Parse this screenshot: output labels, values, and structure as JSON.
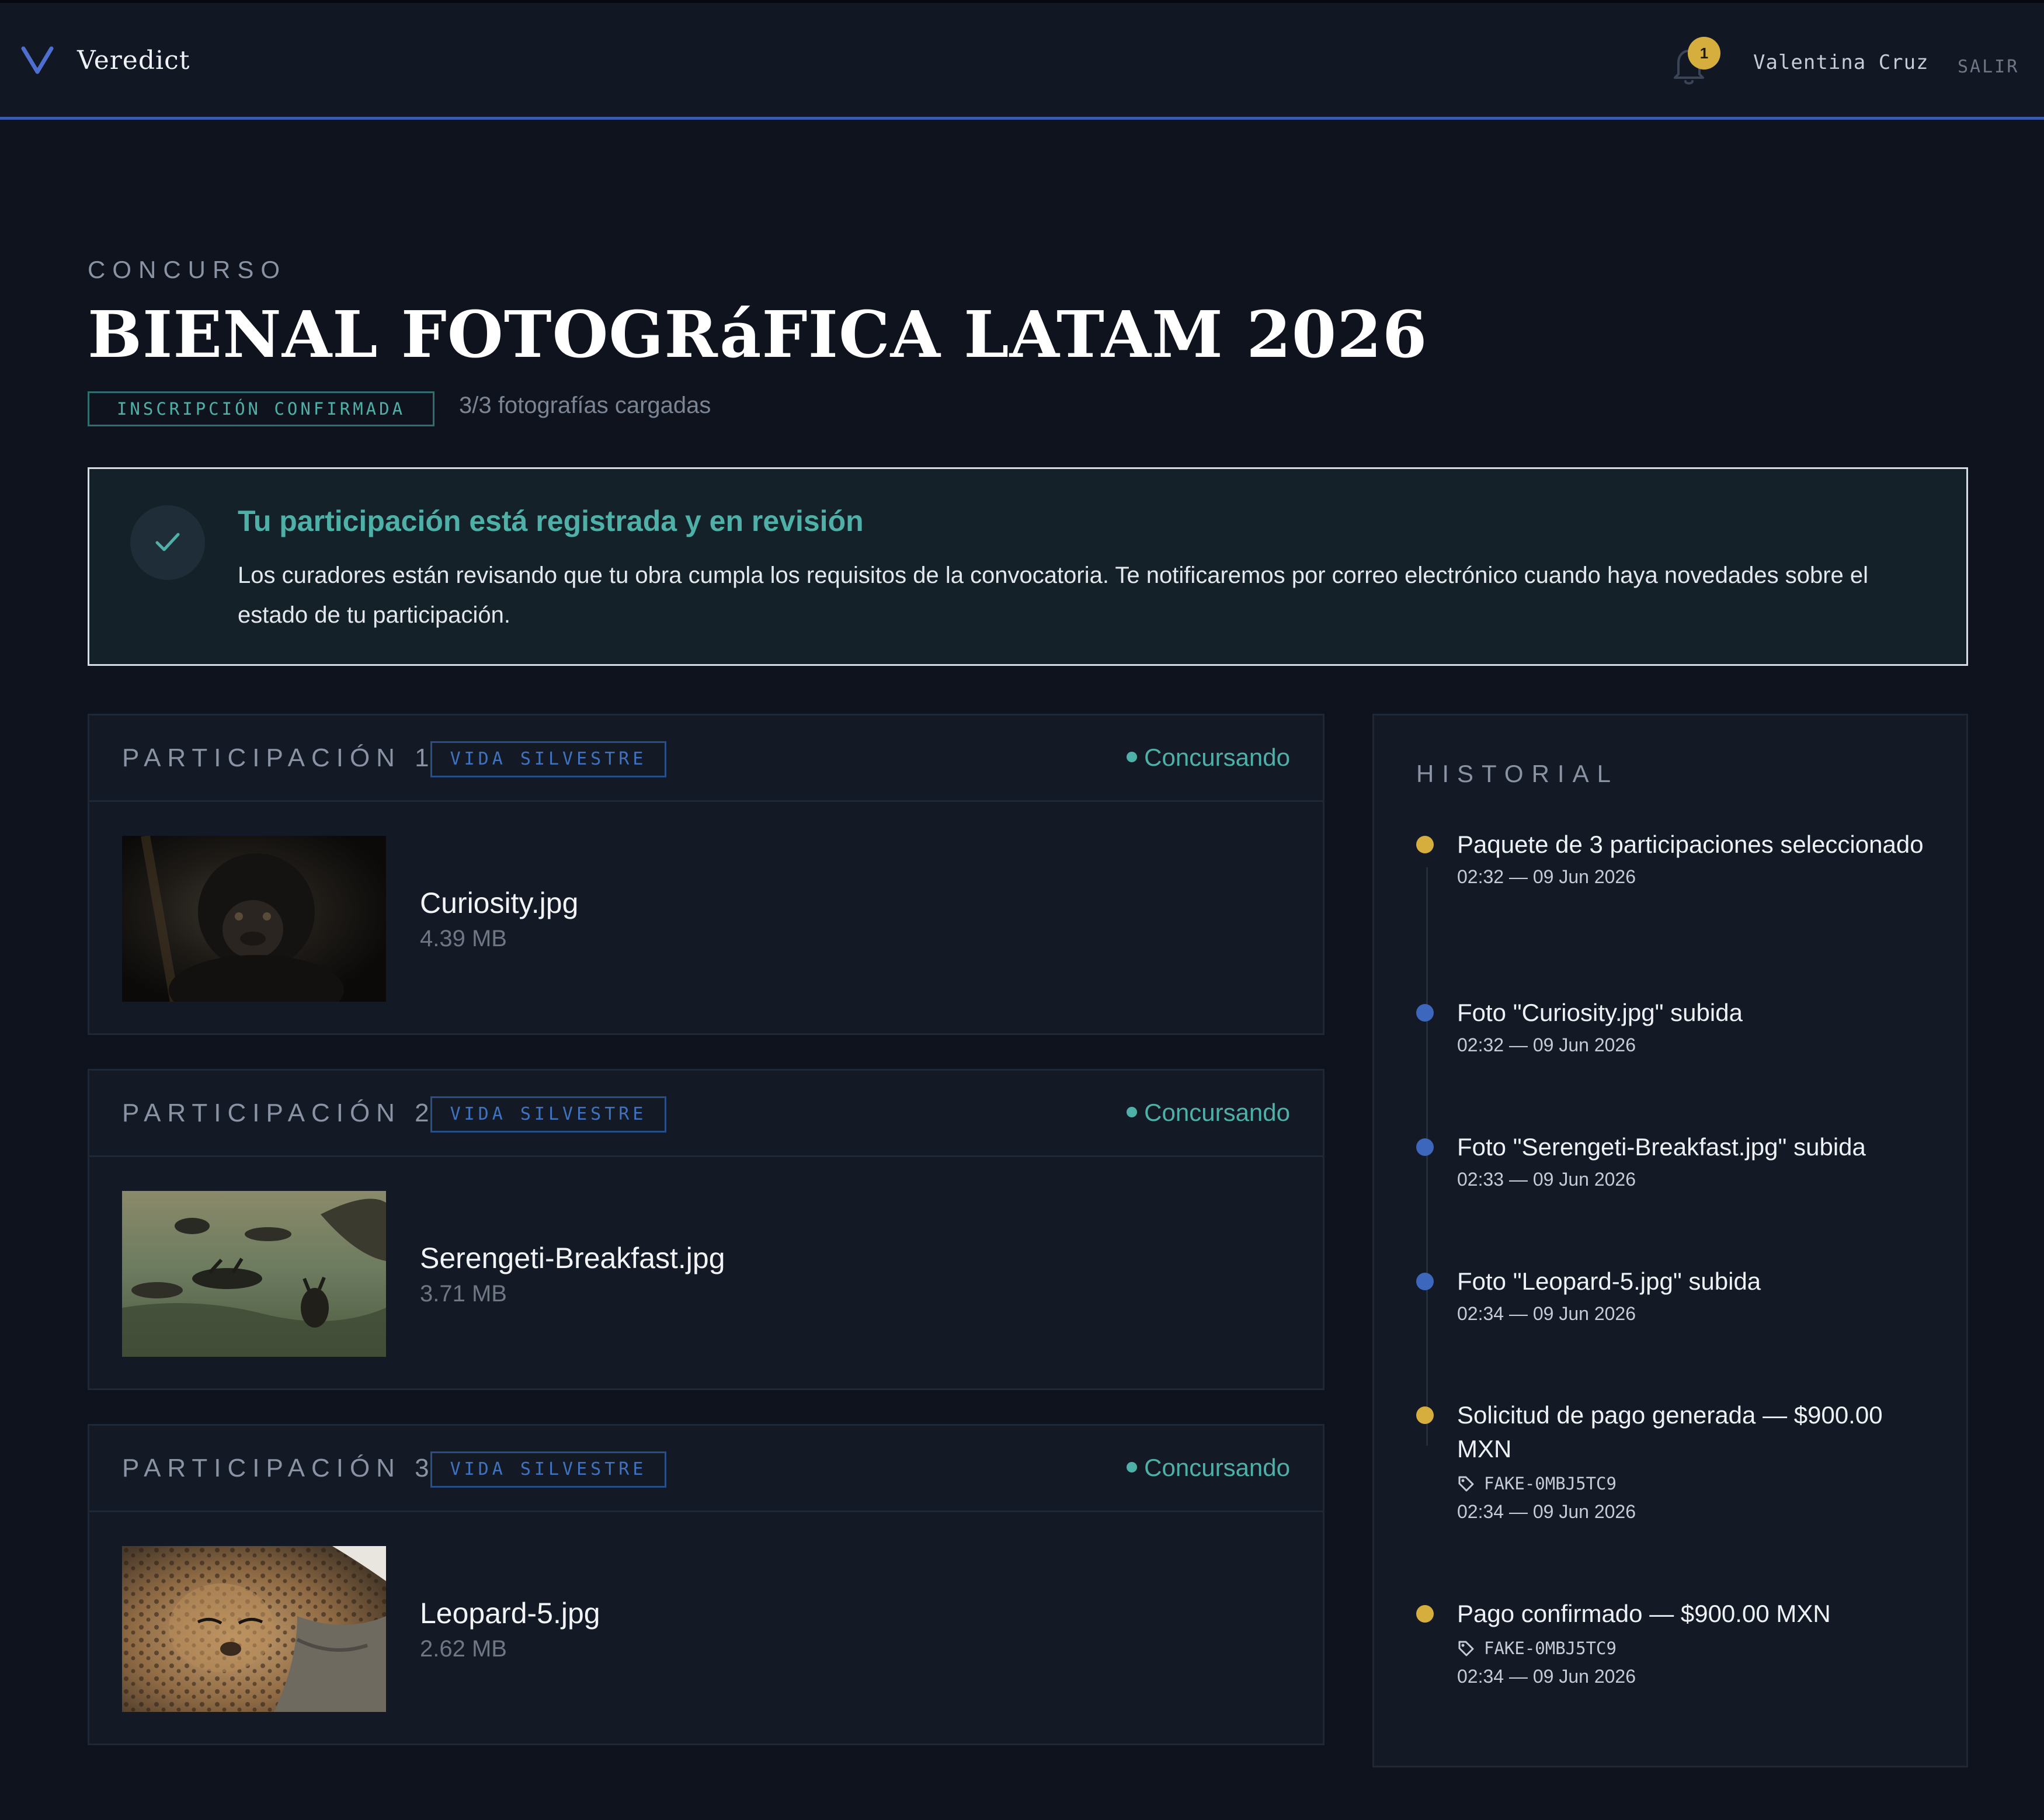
{
  "app": {
    "name": "Veredict"
  },
  "header": {
    "notifications_count": "1",
    "user_name": "Valentina Cruz",
    "logout_label": "SALIR"
  },
  "contest": {
    "eyebrow": "CONCURSO",
    "title": "BIENAL FOTOGRáFICA LATAM 2026",
    "status_tag": "INSCRIPCIÓN CONFIRMADA",
    "photo_count": "3/3 fotografías cargadas"
  },
  "notice": {
    "title": "Tu participación está registrada y en revisión",
    "body": "Los curadores están revisando que tu obra cumpla los requisitos de la convocatoria. Te notificaremos por correo electrónico cuando haya novedades sobre el estado de tu participación."
  },
  "entries": [
    {
      "label": "PARTICIPACIÓN 1",
      "category": "VIDA SILVESTRE",
      "status": "Concursando",
      "file_name": "Curiosity.jpg",
      "file_size": "4.39 MB"
    },
    {
      "label": "PARTICIPACIÓN 2",
      "category": "VIDA SILVESTRE",
      "status": "Concursando",
      "file_name": "Serengeti-Breakfast.jpg",
      "file_size": "3.71 MB"
    },
    {
      "label": "PARTICIPACIÓN 3",
      "category": "VIDA SILVESTRE",
      "status": "Concursando",
      "file_name": "Leopard-5.jpg",
      "file_size": "2.62 MB"
    }
  ],
  "history": {
    "title": "HISTORIAL",
    "items": [
      {
        "text": "Paquete de 3 participaciones seleccionado",
        "time": "02:32 — 09 Jun 2026",
        "color": "#d6ae3e"
      },
      {
        "text": "Foto \"Curiosity.jpg\" subida",
        "time": "02:32 — 09 Jun 2026",
        "color": "#3d67bd"
      },
      {
        "text": "Foto \"Serengeti-Breakfast.jpg\" subida",
        "time": "02:33 — 09 Jun 2026",
        "color": "#3d67bd"
      },
      {
        "text": "Foto \"Leopard-5.jpg\" subida",
        "time": "02:34 — 09 Jun 2026",
        "color": "#3d67bd"
      },
      {
        "text": "Solicitud de pago generada — $900.00 MXN",
        "ref": "FAKE-0MBJ5TC9",
        "time": "02:34 — 09 Jun 2026",
        "color": "#d6ae3e"
      },
      {
        "text": "Pago confirmado — $900.00 MXN",
        "ref": "FAKE-0MBJ5TC9",
        "time": "02:34 — 09 Jun 2026",
        "color": "#d6ae3e"
      }
    ]
  },
  "colors": {
    "background": "#0e131d",
    "header_accent": "#3a5cae",
    "teal": "#4fb0a8",
    "gold": "#d6ae3e",
    "blue": "#3d67bd"
  },
  "icons": {
    "logo": "v-logo-icon",
    "notifications": "bell-icon",
    "notice": "check-icon",
    "reference": "tag-icon"
  }
}
